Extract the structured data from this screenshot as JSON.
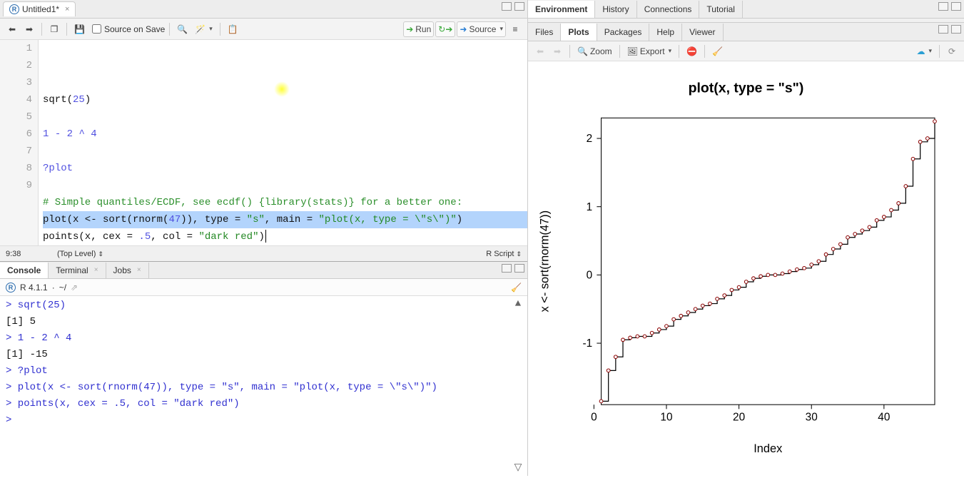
{
  "source_pane": {
    "tab_title": "Untitled1*",
    "source_on_save": "Source on Save",
    "run": "Run",
    "source": "Source",
    "code_lines": [
      {
        "n": 1,
        "parts": [
          {
            "t": "sqrt",
            "c": "fn"
          },
          {
            "t": "(",
            "c": "plain"
          },
          {
            "t": "25",
            "c": "num"
          },
          {
            "t": ")",
            "c": "plain"
          }
        ]
      },
      {
        "n": 2,
        "parts": []
      },
      {
        "n": 3,
        "parts": [
          {
            "t": "1",
            "c": "num"
          },
          {
            "t": " ",
            "c": "plain"
          },
          {
            "t": "-",
            "c": "op"
          },
          {
            "t": " ",
            "c": "plain"
          },
          {
            "t": "2",
            "c": "num"
          },
          {
            "t": " ",
            "c": "plain"
          },
          {
            "t": "^",
            "c": "op"
          },
          {
            "t": " ",
            "c": "plain"
          },
          {
            "t": "4",
            "c": "num"
          }
        ]
      },
      {
        "n": 4,
        "parts": []
      },
      {
        "n": 5,
        "parts": [
          {
            "t": "?plot",
            "c": "op"
          }
        ]
      },
      {
        "n": 6,
        "parts": []
      },
      {
        "n": 7,
        "parts": [
          {
            "t": "# Simple quantiles/ECDF, see ecdf() {library(stats)} for a better one:",
            "c": "cmt"
          }
        ]
      },
      {
        "n": 8,
        "sel": true,
        "parts": [
          {
            "t": "plot(x <- sort(rnorm(",
            "c": "plain"
          },
          {
            "t": "47",
            "c": "num"
          },
          {
            "t": ")), type = ",
            "c": "plain"
          },
          {
            "t": "\"s\"",
            "c": "str"
          },
          {
            "t": ", main = ",
            "c": "plain"
          },
          {
            "t": "\"plot(x, type = \\\"s\\\")\"",
            "c": "str"
          },
          {
            "t": ")",
            "c": "plain"
          }
        ]
      },
      {
        "n": 9,
        "parts": [
          {
            "t": "points(x, cex = ",
            "c": "plain"
          },
          {
            "t": ".5",
            "c": "num"
          },
          {
            "t": ", col = ",
            "c": "plain"
          },
          {
            "t": "\"dark red\"",
            "c": "str"
          },
          {
            "t": ")",
            "c": "plain"
          }
        ]
      }
    ],
    "cursor": "9:38",
    "scope": "(Top Level)",
    "lang": "R Script"
  },
  "console": {
    "tabs": [
      "Console",
      "Terminal",
      "Jobs"
    ],
    "r_ver": "R 4.1.1",
    "wd": "~/",
    "lines": [
      {
        "prompt": ">",
        "text": " sqrt(25)",
        "type": "input"
      },
      {
        "text": "[1] 5",
        "type": "output"
      },
      {
        "prompt": ">",
        "text": " 1 - 2 ^ 4",
        "type": "input"
      },
      {
        "text": "[1] -15",
        "type": "output"
      },
      {
        "prompt": ">",
        "text": " ?plot",
        "type": "input"
      },
      {
        "prompt": ">",
        "text": " plot(x <- sort(rnorm(47)), type = \"s\", main = \"plot(x, type = \\\"s\\\")\")",
        "type": "input"
      },
      {
        "prompt": ">",
        "text": " points(x, cex = .5, col = \"dark red\")",
        "type": "input"
      },
      {
        "prompt": ">",
        "text": " ",
        "type": "input"
      }
    ]
  },
  "env_tabs": [
    "Environment",
    "History",
    "Connections",
    "Tutorial"
  ],
  "plots_tabs": [
    "Files",
    "Plots",
    "Packages",
    "Help",
    "Viewer"
  ],
  "plots_toolbar": {
    "zoom": "Zoom",
    "export": "Export"
  },
  "chart_data": {
    "type": "step+scatter",
    "title": "plot(x, type = \"s\")",
    "xlabel": "Index",
    "ylabel": "x <- sort(rnorm(47))",
    "x_ticks": [
      0,
      10,
      20,
      30,
      40
    ],
    "y_ticks": [
      -1,
      0,
      1,
      2
    ],
    "xlim": [
      1,
      47
    ],
    "ylim": [
      -1.9,
      2.3
    ],
    "point_color": "darkred",
    "x": [
      1,
      2,
      3,
      4,
      5,
      6,
      7,
      8,
      9,
      10,
      11,
      12,
      13,
      14,
      15,
      16,
      17,
      18,
      19,
      20,
      21,
      22,
      23,
      24,
      25,
      26,
      27,
      28,
      29,
      30,
      31,
      32,
      33,
      34,
      35,
      36,
      37,
      38,
      39,
      40,
      41,
      42,
      43,
      44,
      45,
      46,
      47
    ],
    "y": [
      -1.85,
      -1.4,
      -1.2,
      -0.95,
      -0.92,
      -0.9,
      -0.9,
      -0.85,
      -0.8,
      -0.75,
      -0.65,
      -0.6,
      -0.55,
      -0.5,
      -0.45,
      -0.42,
      -0.35,
      -0.3,
      -0.22,
      -0.18,
      -0.1,
      -0.05,
      -0.02,
      0,
      0.0,
      0.02,
      0.05,
      0.08,
      0.1,
      0.15,
      0.2,
      0.3,
      0.38,
      0.45,
      0.55,
      0.6,
      0.65,
      0.7,
      0.8,
      0.85,
      0.95,
      1.05,
      1.3,
      1.7,
      1.95,
      2.0,
      2.25
    ]
  }
}
